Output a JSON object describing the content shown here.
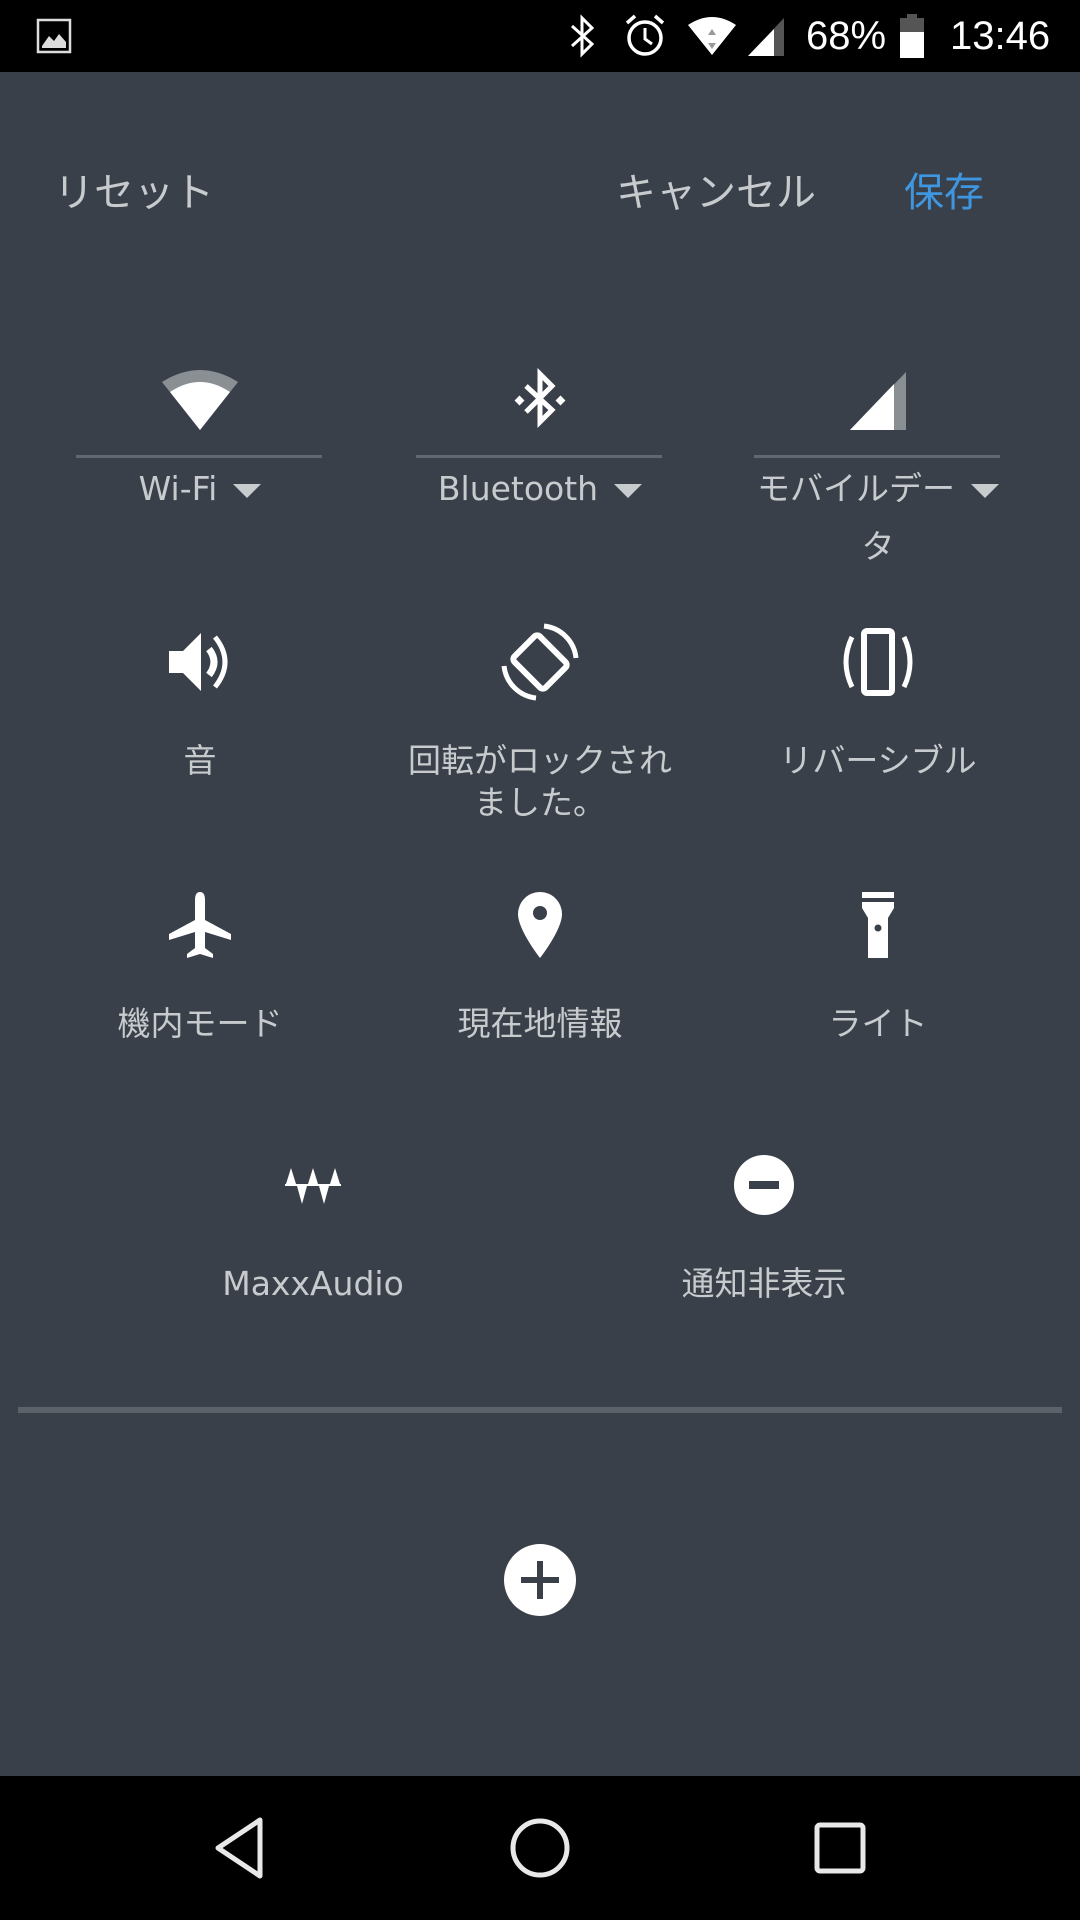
{
  "status_bar": {
    "notification_icon": "image-icon",
    "icons": [
      "bluetooth-icon",
      "alarm-icon",
      "wifi-icon",
      "cell-signal-icon"
    ],
    "battery_percent": "68%",
    "time": "13:46"
  },
  "header": {
    "reset_label": "リセット",
    "cancel_label": "キャンセル",
    "save_label": "保存",
    "save_color": "#3f96e0"
  },
  "tiles": [
    {
      "id": "wifi",
      "label": "Wi-Fi",
      "icon": "wifi-icon",
      "dual": true
    },
    {
      "id": "bluetooth",
      "label": "Bluetooth",
      "icon": "bluetooth-icon",
      "dual": true
    },
    {
      "id": "mobile-data",
      "label": "モバイルデー",
      "label_line2": "タ",
      "icon": "cell-signal-icon",
      "dual": true
    },
    {
      "id": "sound",
      "label": "音",
      "icon": "volume-icon"
    },
    {
      "id": "rotation-lock",
      "label": "回転がロックされ",
      "label_line2": "ました。",
      "icon": "screen-rotation-icon"
    },
    {
      "id": "reversible",
      "label": "リバーシブル",
      "icon": "reversible-phone-icon"
    },
    {
      "id": "airplane",
      "label": "機内モード",
      "icon": "airplane-icon"
    },
    {
      "id": "location",
      "label": "現在地情報",
      "icon": "location-pin-icon"
    },
    {
      "id": "flashlight",
      "label": "ライト",
      "icon": "flashlight-icon"
    },
    {
      "id": "maxxaudio",
      "label": "MaxxAudio",
      "icon": "maxxaudio-icon"
    },
    {
      "id": "dnd",
      "label": "通知非表示",
      "icon": "do-not-disturb-icon"
    }
  ],
  "add_tile": {
    "icon": "add-circle-icon"
  },
  "nav_bar": {
    "buttons": [
      "back-icon",
      "home-icon",
      "recents-icon"
    ]
  },
  "colors": {
    "background": "#394049",
    "text": "#c8cbce",
    "accent": "#3f96e0"
  }
}
